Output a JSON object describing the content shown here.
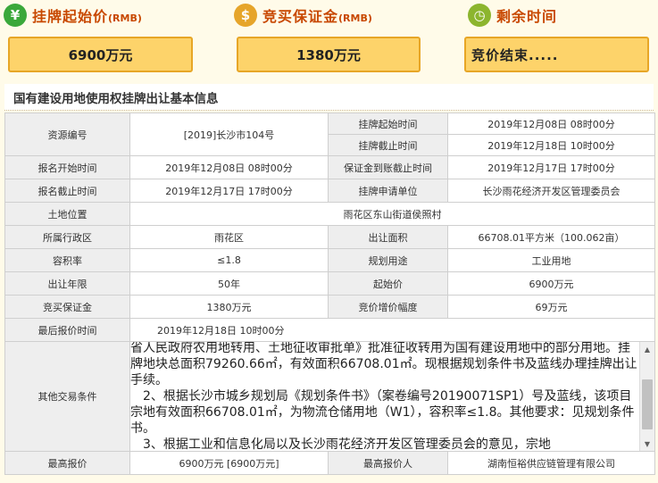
{
  "header": {
    "start_price": {
      "label": "挂牌起始价",
      "unit": "(RMB)",
      "value": "6900万元",
      "icon": "money-bag-icon"
    },
    "deposit": {
      "label": "竞买保证金",
      "unit": "(RMB)",
      "value": "1380万元",
      "icon": "coins-icon"
    },
    "time_left": {
      "label": "剩余时间",
      "value": "竞价结束.....",
      "icon": "clock-icon"
    }
  },
  "section_title": "国有建设用地使用权挂牌出让基本信息",
  "table": {
    "resource_no_label": "资源编号",
    "resource_no": "[2019]长沙市104号",
    "listing_start_label": "挂牌起始时间",
    "listing_start": "2019年12月08日 08时00分",
    "listing_end_label": "挂牌截止时间",
    "listing_end": "2019年12月18日 10时00分",
    "signup_start_label": "报名开始时间",
    "signup_start": "2019年12月08日 08时00分",
    "deposit_deadline_label": "保证金到账截止时间",
    "deposit_deadline": "2019年12月17日 17时00分",
    "signup_end_label": "报名截止时间",
    "signup_end": "2019年12月17日 17时00分",
    "applicant_label": "挂牌申请单位",
    "applicant": "长沙雨花经济开发区管理委员会",
    "location_label": "土地位置",
    "location": "雨花区东山街道侯照村",
    "district_label": "所属行政区",
    "district": "雨花区",
    "area_label": "出让面积",
    "area": "66708.01平方米（100.062亩）",
    "far_label": "容积率",
    "far": "≤1.8",
    "usage_label": "规划用途",
    "usage": "工业用地",
    "term_label": "出让年限",
    "term": "50年",
    "start_price_label": "起始价",
    "start_price": "6900万元",
    "deposit_label": "竞买保证金",
    "deposit": "1380万元",
    "increment_label": "竞价增价幅度",
    "increment": "69万元",
    "last_bid_time_label": "最后报价时间",
    "last_bid_time": "2019年12月18日 10时00分",
    "other_label": "其他交易条件",
    "other_line1": "省人民政府农用地转用、土地征收审批单》批准征收转用为国有建设用地中的部分用地。挂牌地块总面积79260.66㎡，有效面积66708.01㎡。现根据规划条件书及蓝线办理挂牌出让手续。",
    "other_line2": "2、根据长沙市城乡规划局《规划条件书》（案卷编号20190071SP1）号及蓝线，该项目宗地有效面积66708.01㎡，为物流仓储用地（W1），容积率≤1.8。其他要求：见规划条件书。",
    "other_line3": "3、根据工业和信息化局以及长沙雨花经济开发区管理委员会的意见，宗地",
    "highest_bid_label": "最高报价",
    "highest_bid": "6900万元 [6900万元]",
    "highest_bidder_label": "最高报价人",
    "highest_bidder": "湖南恒裕供应链管理有限公司"
  }
}
